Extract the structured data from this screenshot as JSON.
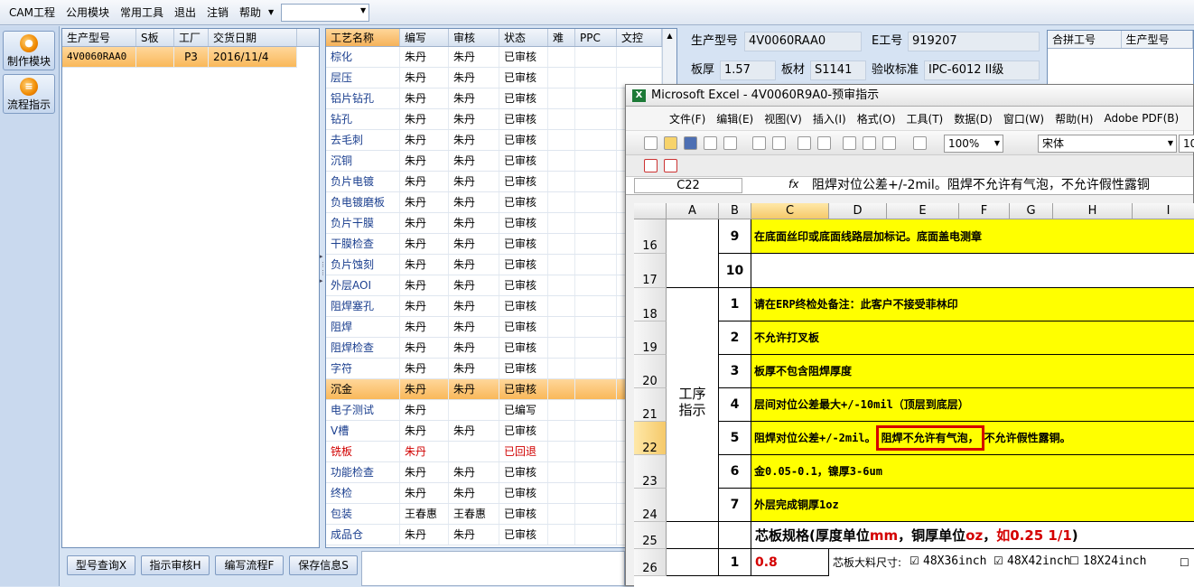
{
  "menubar": {
    "items": [
      "CAM工程",
      "公用模块",
      "常用工具",
      "退出",
      "注销",
      "帮助"
    ]
  },
  "sidebar": {
    "buttons": [
      {
        "label": "制作模块"
      },
      {
        "label": "流程指示"
      }
    ]
  },
  "orders": {
    "headers": [
      "生产型号",
      "S板",
      "工厂",
      "交货日期"
    ],
    "rows": [
      {
        "model": "4V0060RAA0",
        "s": "",
        "factory": "P3",
        "date": "2016/11/4"
      }
    ]
  },
  "process": {
    "headers": [
      "工艺名称",
      "编写",
      "审核",
      "状态",
      "难",
      "PPC",
      "文控"
    ],
    "rows": [
      {
        "name": "棕化",
        "writer": "朱丹",
        "reviewer": "朱丹",
        "status": "已审核"
      },
      {
        "name": "层压",
        "writer": "朱丹",
        "reviewer": "朱丹",
        "status": "已审核"
      },
      {
        "name": "铝片钻孔",
        "writer": "朱丹",
        "reviewer": "朱丹",
        "status": "已审核"
      },
      {
        "name": "钻孔",
        "writer": "朱丹",
        "reviewer": "朱丹",
        "status": "已审核"
      },
      {
        "name": "去毛刺",
        "writer": "朱丹",
        "reviewer": "朱丹",
        "status": "已审核"
      },
      {
        "name": "沉铜",
        "writer": "朱丹",
        "reviewer": "朱丹",
        "status": "已审核"
      },
      {
        "name": "负片电镀",
        "writer": "朱丹",
        "reviewer": "朱丹",
        "status": "已审核"
      },
      {
        "name": "负电镀磨板",
        "writer": "朱丹",
        "reviewer": "朱丹",
        "status": "已审核"
      },
      {
        "name": "负片干膜",
        "writer": "朱丹",
        "reviewer": "朱丹",
        "status": "已审核"
      },
      {
        "name": "干膜检查",
        "writer": "朱丹",
        "reviewer": "朱丹",
        "status": "已审核"
      },
      {
        "name": "负片蚀刻",
        "writer": "朱丹",
        "reviewer": "朱丹",
        "status": "已审核"
      },
      {
        "name": "外层AOI",
        "writer": "朱丹",
        "reviewer": "朱丹",
        "status": "已审核"
      },
      {
        "name": "阻焊塞孔",
        "writer": "朱丹",
        "reviewer": "朱丹",
        "status": "已审核"
      },
      {
        "name": "阻焊",
        "writer": "朱丹",
        "reviewer": "朱丹",
        "status": "已审核"
      },
      {
        "name": "阻焊检查",
        "writer": "朱丹",
        "reviewer": "朱丹",
        "status": "已审核"
      },
      {
        "name": "字符",
        "writer": "朱丹",
        "reviewer": "朱丹",
        "status": "已审核"
      },
      {
        "name": "沉金",
        "writer": "朱丹",
        "reviewer": "朱丹",
        "status": "已审核",
        "selected": true
      },
      {
        "name": "电子测试",
        "writer": "朱丹",
        "reviewer": "",
        "status": "已编写"
      },
      {
        "name": "V槽",
        "writer": "朱丹",
        "reviewer": "朱丹",
        "status": "已审核"
      },
      {
        "name": "铣板",
        "writer": "朱丹",
        "reviewer": "",
        "status": "已回退",
        "red": true
      },
      {
        "name": "功能检查",
        "writer": "朱丹",
        "reviewer": "朱丹",
        "status": "已审核"
      },
      {
        "name": "终检",
        "writer": "朱丹",
        "reviewer": "朱丹",
        "status": "已审核"
      },
      {
        "name": "包装",
        "writer": "王春惠",
        "reviewer": "王春惠",
        "status": "已审核"
      },
      {
        "name": "成品仓",
        "writer": "朱丹",
        "reviewer": "朱丹",
        "status": "已审核"
      }
    ]
  },
  "buttons": [
    "型号查询X",
    "指示审核H",
    "编写流程F",
    "保存信息S"
  ],
  "info": {
    "model_label": "生产型号",
    "model": "4V0060RAA0",
    "eno_label": "E工号",
    "eno": "919207",
    "thick_label": "板厚",
    "thick": "1.57",
    "mat_label": "板材",
    "mat": "S1141",
    "std_label": "验收标准",
    "std": "IPC-6012 II级",
    "merge_headers": [
      "合拼工号",
      "生产型号"
    ]
  },
  "excel": {
    "title": "Microsoft Excel - 4V0060R9A0-预审指示",
    "menu": [
      "文件(F)",
      "编辑(E)",
      "视图(V)",
      "插入(I)",
      "格式(O)",
      "工具(T)",
      "数据(D)",
      "窗口(W)",
      "帮助(H)",
      "Adobe PDF(B)"
    ],
    "zoom": "100%",
    "font": "宋体",
    "font_size": "10",
    "namebox": "C22",
    "formula": "阻焊对位公差+/-2mil。阻焊不允许有气泡，不允许假性露铜",
    "cols": [
      "A",
      "B",
      "C",
      "D",
      "E",
      "F",
      "G",
      "H",
      "I"
    ],
    "section_label": "工序指示",
    "rows": [
      {
        "r": "16",
        "n": "9",
        "text": "在底面丝印或底面线路层加标记。底面盖电测章"
      },
      {
        "r": "17",
        "n": "10",
        "text": ""
      },
      {
        "r": "18",
        "n": "1",
        "text": "请在ERP终检处备注：此客户不接受菲林印"
      },
      {
        "r": "19",
        "n": "2",
        "text": "不允许打叉板"
      },
      {
        "r": "20",
        "n": "3",
        "text": "板厚不包含阻焊厚度"
      },
      {
        "r": "21",
        "n": "4",
        "text": "层间对位公差最大+/-10mil（顶层到底层）"
      },
      {
        "r": "22",
        "n": "5",
        "text_a": "阻焊对位公差+/-2mil。",
        "text_b": "阻焊不允许有气泡，",
        "text_c": "不允许假性露铜。"
      },
      {
        "r": "23",
        "n": "6",
        "text": "金0.05-0.1，镍厚3-6um"
      },
      {
        "r": "24",
        "n": "7",
        "text": "外层完成铜厚1oz"
      }
    ],
    "row25": {
      "r": "25",
      "a": "芯板规格(厚度单位",
      "b": "mm",
      "c": "，铜厚单位",
      "d": "oz",
      "e": "，",
      "f": "如0.25 1/1",
      ")": ")"
    },
    "row26": {
      "r": "26",
      "n": "1",
      "val": "0.8",
      "lab": "芯板大料尺寸:",
      "o1": "48X36inch",
      "o2": "48X42inch",
      "o3": "18X24inch"
    }
  }
}
